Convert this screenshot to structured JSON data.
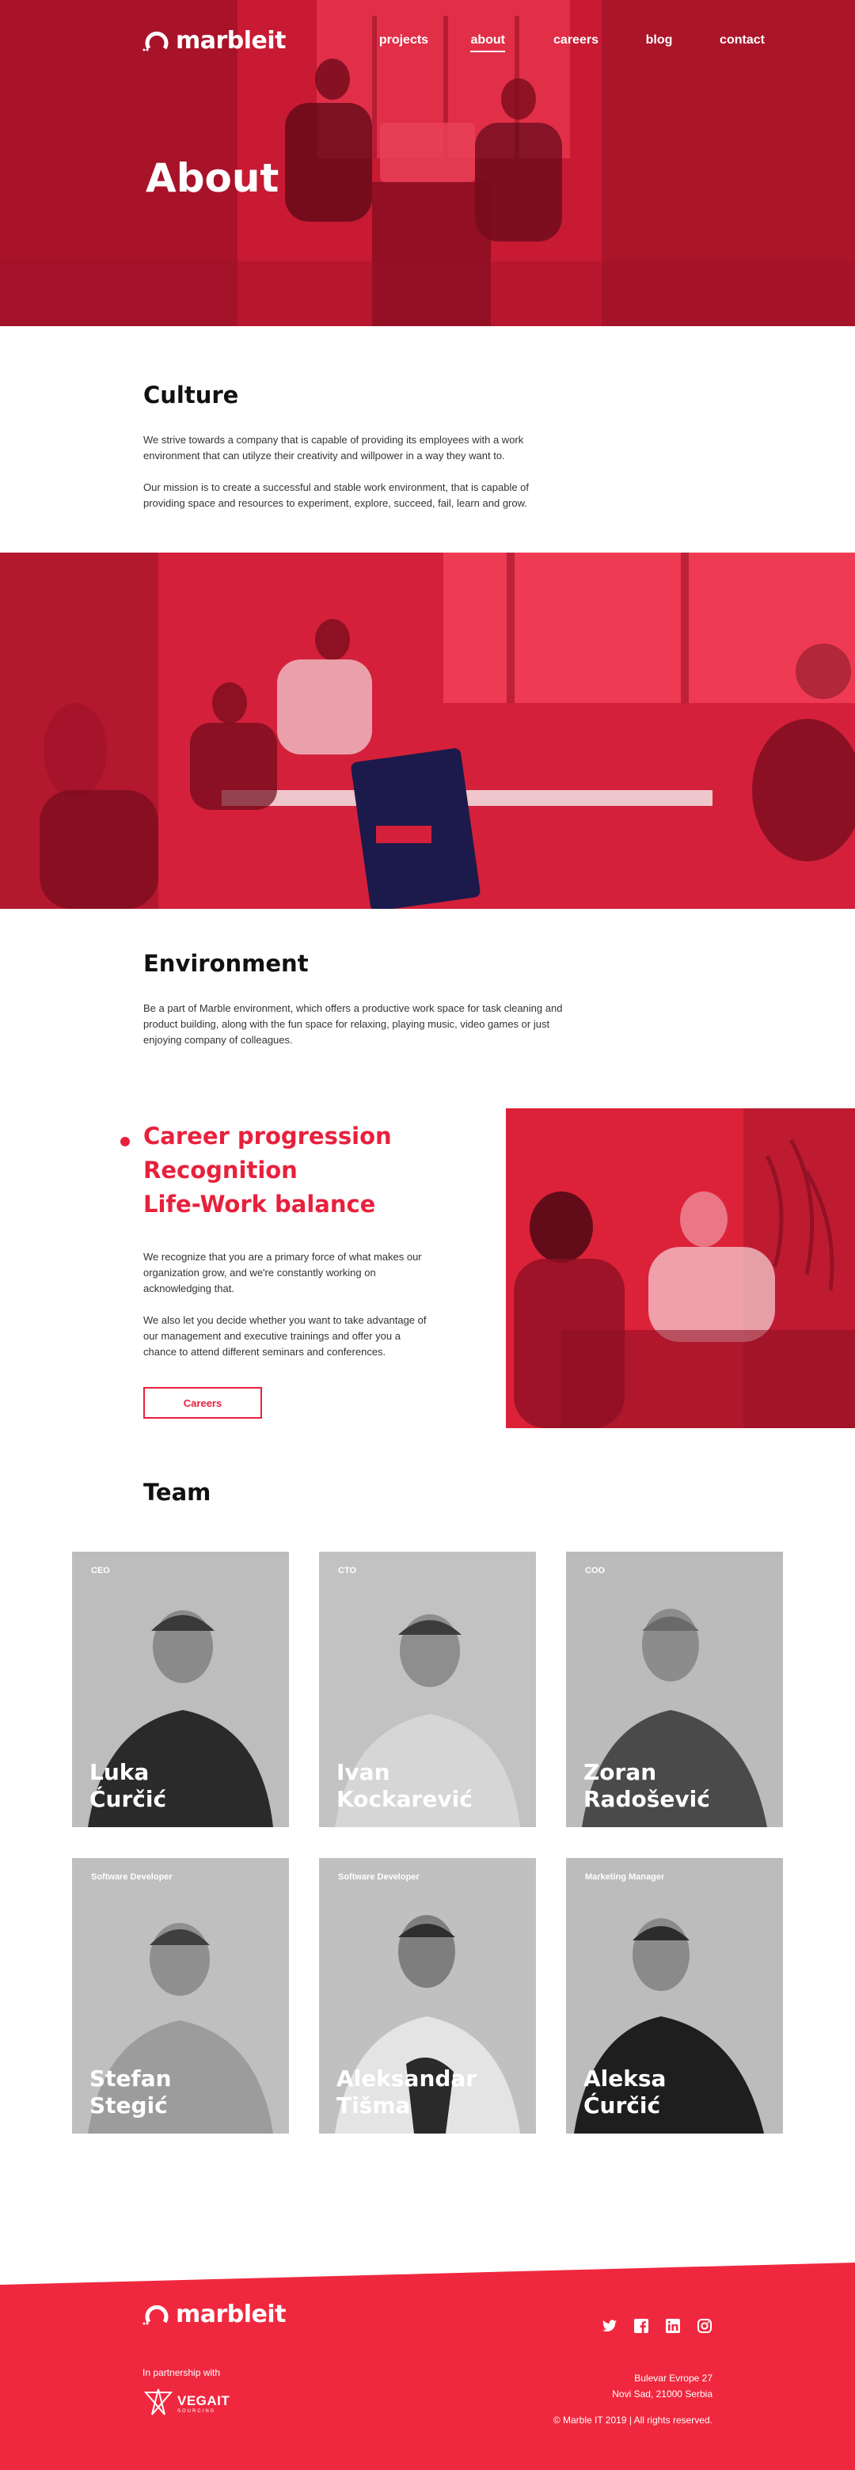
{
  "nav": {
    "logo_text": "marbleit",
    "links": [
      "projects",
      "about",
      "careers",
      "blog",
      "contact"
    ],
    "active": "about"
  },
  "hero": {
    "title": "About"
  },
  "culture": {
    "title": "Culture",
    "paragraphs": [
      "We strive towards a company that is capable of providing its employees with a work environment that can utilyze their creativity and willpower in a way they want to.",
      "Our mission is to create a successful and stable work environment, that is capable of providing space and resources to experiment, explore, succeed, fail, learn and grow."
    ]
  },
  "environment": {
    "title": "Environment",
    "text": "Be a part of Marble environment, which offers a productive work space for task cleaning and product building, along with the fun space for relaxing, playing music, video games or just enjoying company of colleagues."
  },
  "career": {
    "headings": [
      "Career progression",
      "Recognition",
      "Life-Work balance"
    ],
    "paragraphs": [
      "We recognize that you are a primary force of what makes our organization grow, and we're constantly working on acknowledging that.",
      "We also let you decide whether you want to take advantage of our management and executive trainings and offer you a chance to attend different seminars and conferences."
    ],
    "button_label": "Careers"
  },
  "team": {
    "title": "Team",
    "members": [
      {
        "role": "CEO",
        "first": "Luka",
        "last": "Ćurčić"
      },
      {
        "role": "CTO",
        "first": "Ivan",
        "last": "Kockarević"
      },
      {
        "role": "COO",
        "first": "Zoran",
        "last": "Radošević"
      },
      {
        "role": "Software Developer",
        "first": "Stefan",
        "last": "Stegić"
      },
      {
        "role": "Software Developer",
        "first": "Aleksandar",
        "last": "Tišma"
      },
      {
        "role": "Marketing Manager",
        "first": "Aleksa",
        "last": "Ćurčić"
      }
    ]
  },
  "footer": {
    "logo_text": "marbleit",
    "partner_label": "In partnership with",
    "partner_name": "VEGAIT",
    "partner_sub": "SOURCING",
    "social_icons": [
      "twitter-icon",
      "facebook-icon",
      "linkedin-icon",
      "instagram-icon"
    ],
    "address_line1": "Bulevar Evrope 27",
    "address_line2": "Novi Sad, 21000 Serbia",
    "copyright": "© Marble IT 2019 | All rights reserved."
  },
  "colors": {
    "accent": "#e8203c",
    "footer_bg": "#f0283f",
    "card_bg": "#b8b8b8"
  }
}
